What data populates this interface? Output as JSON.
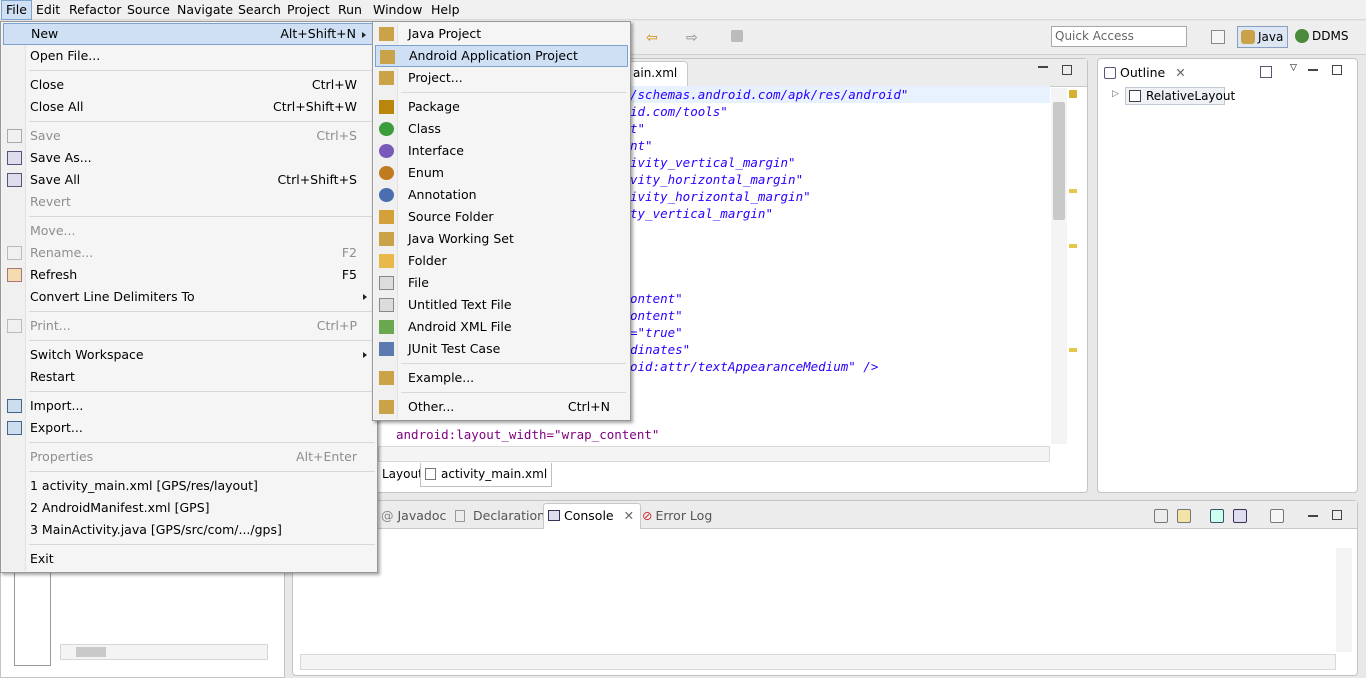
{
  "menubar": [
    "File",
    "Edit",
    "Refactor",
    "Source",
    "Navigate",
    "Search",
    "Project",
    "Run",
    "Window",
    "Help"
  ],
  "toolbar": {
    "quick_access": "Quick Access",
    "perspectives": [
      "Java",
      "DDMS"
    ]
  },
  "editor": {
    "tab_label": "ain.xml",
    "code_lines": [
      "/schemas.android.com/apk/res/android\"",
      "id.com/tools\"",
      "t\"",
      "nt\"",
      "ivity_vertical_margin\"",
      "vity_horizontal_margin\"",
      "ivity_horizontal_margin\"",
      "ty_vertical_margin\"",
      "",
      "",
      "",
      "",
      "ontent\"",
      "ontent\"",
      "=\"true\"",
      "dinates\"",
      "oid:attr/textAppearanceMedium\" />"
    ],
    "bottom_code_line": "android:layout_width=\"wrap_content\"",
    "bottom_tabs": [
      "Layout",
      "activity_main.xml"
    ]
  },
  "outline": {
    "title": "Outline",
    "tree_item": "RelativeLayout"
  },
  "console": {
    "tabs": [
      "Javadoc",
      "Declaration",
      "Console",
      "Error Log"
    ]
  },
  "file_menu": {
    "items": [
      {
        "label": "New",
        "shortcut": "Alt+Shift+N",
        "submenu": true,
        "hover": true
      },
      {
        "label": "Open File...",
        "shortcut": ""
      },
      {
        "label": "Close",
        "shortcut": "Ctrl+W"
      },
      {
        "label": "Close All",
        "shortcut": "Ctrl+Shift+W"
      },
      {
        "label": "Save",
        "shortcut": "Ctrl+S",
        "disabled": true
      },
      {
        "label": "Save As...",
        "shortcut": ""
      },
      {
        "label": "Save All",
        "shortcut": "Ctrl+Shift+S"
      },
      {
        "label": "Revert",
        "shortcut": "",
        "disabled": true
      },
      {
        "label": "Move...",
        "shortcut": "",
        "disabled": true
      },
      {
        "label": "Rename...",
        "shortcut": "F2",
        "disabled": true
      },
      {
        "label": "Refresh",
        "shortcut": "F5"
      },
      {
        "label": "Convert Line Delimiters To",
        "shortcut": "",
        "submenu": true
      },
      {
        "label": "Print...",
        "shortcut": "Ctrl+P",
        "disabled": true
      },
      {
        "label": "Switch Workspace",
        "shortcut": "",
        "submenu": true
      },
      {
        "label": "Restart",
        "shortcut": ""
      },
      {
        "label": "Import...",
        "shortcut": ""
      },
      {
        "label": "Export...",
        "shortcut": ""
      },
      {
        "label": "Properties",
        "shortcut": "Alt+Enter",
        "disabled": true
      },
      {
        "label": "1 activity_main.xml  [GPS/res/layout]",
        "shortcut": ""
      },
      {
        "label": "2 AndroidManifest.xml  [GPS]",
        "shortcut": ""
      },
      {
        "label": "3 MainActivity.java  [GPS/src/com/.../gps]",
        "shortcut": ""
      },
      {
        "label": "Exit",
        "shortcut": ""
      }
    ]
  },
  "new_submenu": {
    "items": [
      {
        "label": "Java Project",
        "icon": "java-project-icon",
        "color": "#c9a24a"
      },
      {
        "label": "Android Application Project",
        "icon": "android-project-icon",
        "color": "#c9a24a",
        "hover": true
      },
      {
        "label": "Project...",
        "icon": "project-icon",
        "color": "#c9a24a"
      },
      {
        "label": "Package",
        "icon": "package-icon",
        "color": "#b8860b"
      },
      {
        "label": "Class",
        "icon": "class-icon",
        "color": "#3a9c3a"
      },
      {
        "label": "Interface",
        "icon": "interface-icon",
        "color": "#7a5ab8"
      },
      {
        "label": "Enum",
        "icon": "enum-icon",
        "color": "#c07a20"
      },
      {
        "label": "Annotation",
        "icon": "annotation-icon",
        "color": "#4a6fb0"
      },
      {
        "label": "Source Folder",
        "icon": "source-folder-icon",
        "color": "#d4a03a"
      },
      {
        "label": "Java Working Set",
        "icon": "working-set-icon",
        "color": "#c9a24a"
      },
      {
        "label": "Folder",
        "icon": "folder-icon",
        "color": "#e8b84a"
      },
      {
        "label": "File",
        "icon": "file-icon",
        "color": "#dcdcdc"
      },
      {
        "label": "Untitled Text File",
        "icon": "text-file-icon",
        "color": "#dcdcdc"
      },
      {
        "label": "Android XML File",
        "icon": "android-xml-icon",
        "color": "#6aa84f"
      },
      {
        "label": "JUnit Test Case",
        "icon": "junit-icon",
        "color": "#5a7ab0"
      },
      {
        "label": "Example...",
        "icon": "example-icon",
        "color": "#c9a24a"
      },
      {
        "label": "Other...",
        "shortcut": "Ctrl+N",
        "icon": "other-icon",
        "color": "#c9a24a"
      }
    ]
  }
}
